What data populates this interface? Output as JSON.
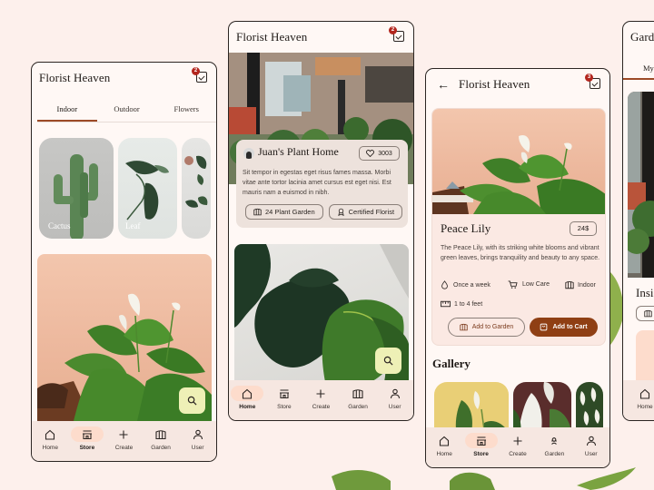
{
  "brand": {
    "accent": "#9c4a26",
    "background": "#fdf0ec",
    "fab": "#eef0b6",
    "nav_active": "#fddccc",
    "badge": "#b3261e"
  },
  "screen1": {
    "title": "Florist Heaven",
    "cart_badge": "2",
    "tabs": [
      {
        "label": "Indoor",
        "active": true
      },
      {
        "label": "Outdoor",
        "active": false
      },
      {
        "label": "Flowers",
        "active": false
      }
    ],
    "categories": [
      {
        "label": "Cactus"
      },
      {
        "label": "Leaf"
      },
      {
        "label": ""
      }
    ],
    "fab_icon": "search-icon",
    "nav": [
      {
        "label": "Home",
        "icon": "home-icon",
        "active": false
      },
      {
        "label": "Store",
        "icon": "store-icon",
        "active": true
      },
      {
        "label": "Create",
        "icon": "plus-icon",
        "active": false
      },
      {
        "label": "Garden",
        "icon": "garden-icon",
        "active": false
      },
      {
        "label": "User",
        "icon": "user-icon",
        "active": false
      }
    ]
  },
  "screen2": {
    "title": "Florist Heaven",
    "cart_badge": "2",
    "shop": {
      "name": "Juan's Plant Home",
      "likes": "3003",
      "description": "Sit tempor in egestas eget risus fames massa. Morbi vitae ante tortor lacinia amet cursus est eget nisi. Est mauris nam a euismod in nibh.",
      "chips": [
        {
          "label": "24 Plant Garden",
          "icon": "garden-icon"
        },
        {
          "label": "Certified Florist",
          "icon": "certified-icon"
        }
      ]
    },
    "fab_icon": "search-icon",
    "nav": [
      {
        "label": "Home",
        "icon": "home-icon",
        "active": true
      },
      {
        "label": "Store",
        "icon": "store-icon",
        "active": false
      },
      {
        "label": "Create",
        "icon": "plus-icon",
        "active": false
      },
      {
        "label": "Garden",
        "icon": "garden-icon",
        "active": false
      },
      {
        "label": "User",
        "icon": "user-icon",
        "active": false
      }
    ]
  },
  "screen3": {
    "title": "Florist Heaven",
    "cart_badge": "3",
    "product": {
      "name": "Peace Lily",
      "price": "24$",
      "description": "The Peace Lily, with its striking white blooms and vibrant green leaves, brings tranquility and beauty to any space.",
      "attributes": [
        {
          "label": "Once a week",
          "icon": "water-drop-icon"
        },
        {
          "label": "Low Care",
          "icon": "cart-care-icon"
        },
        {
          "label": "Indoor",
          "icon": "garden-icon"
        },
        {
          "label": "1 to 4 feet",
          "icon": "ruler-icon"
        }
      ],
      "add_to_garden": "Add to Garden",
      "add_to_cart": "Add to Cart"
    },
    "gallery_title": "Gallery",
    "nav": [
      {
        "label": "Home",
        "icon": "home-icon",
        "active": false
      },
      {
        "label": "Store",
        "icon": "store-icon",
        "active": true
      },
      {
        "label": "Create",
        "icon": "plus-icon",
        "active": false
      },
      {
        "label": "Garden",
        "icon": "garden-user-icon",
        "active": false
      },
      {
        "label": "User",
        "icon": "user-icon",
        "active": false
      }
    ]
  },
  "screen4": {
    "title": "Gard",
    "tab": "My",
    "item_title": "Insi",
    "nav": [
      {
        "label": "Home",
        "icon": "home-icon",
        "active": false
      }
    ]
  }
}
